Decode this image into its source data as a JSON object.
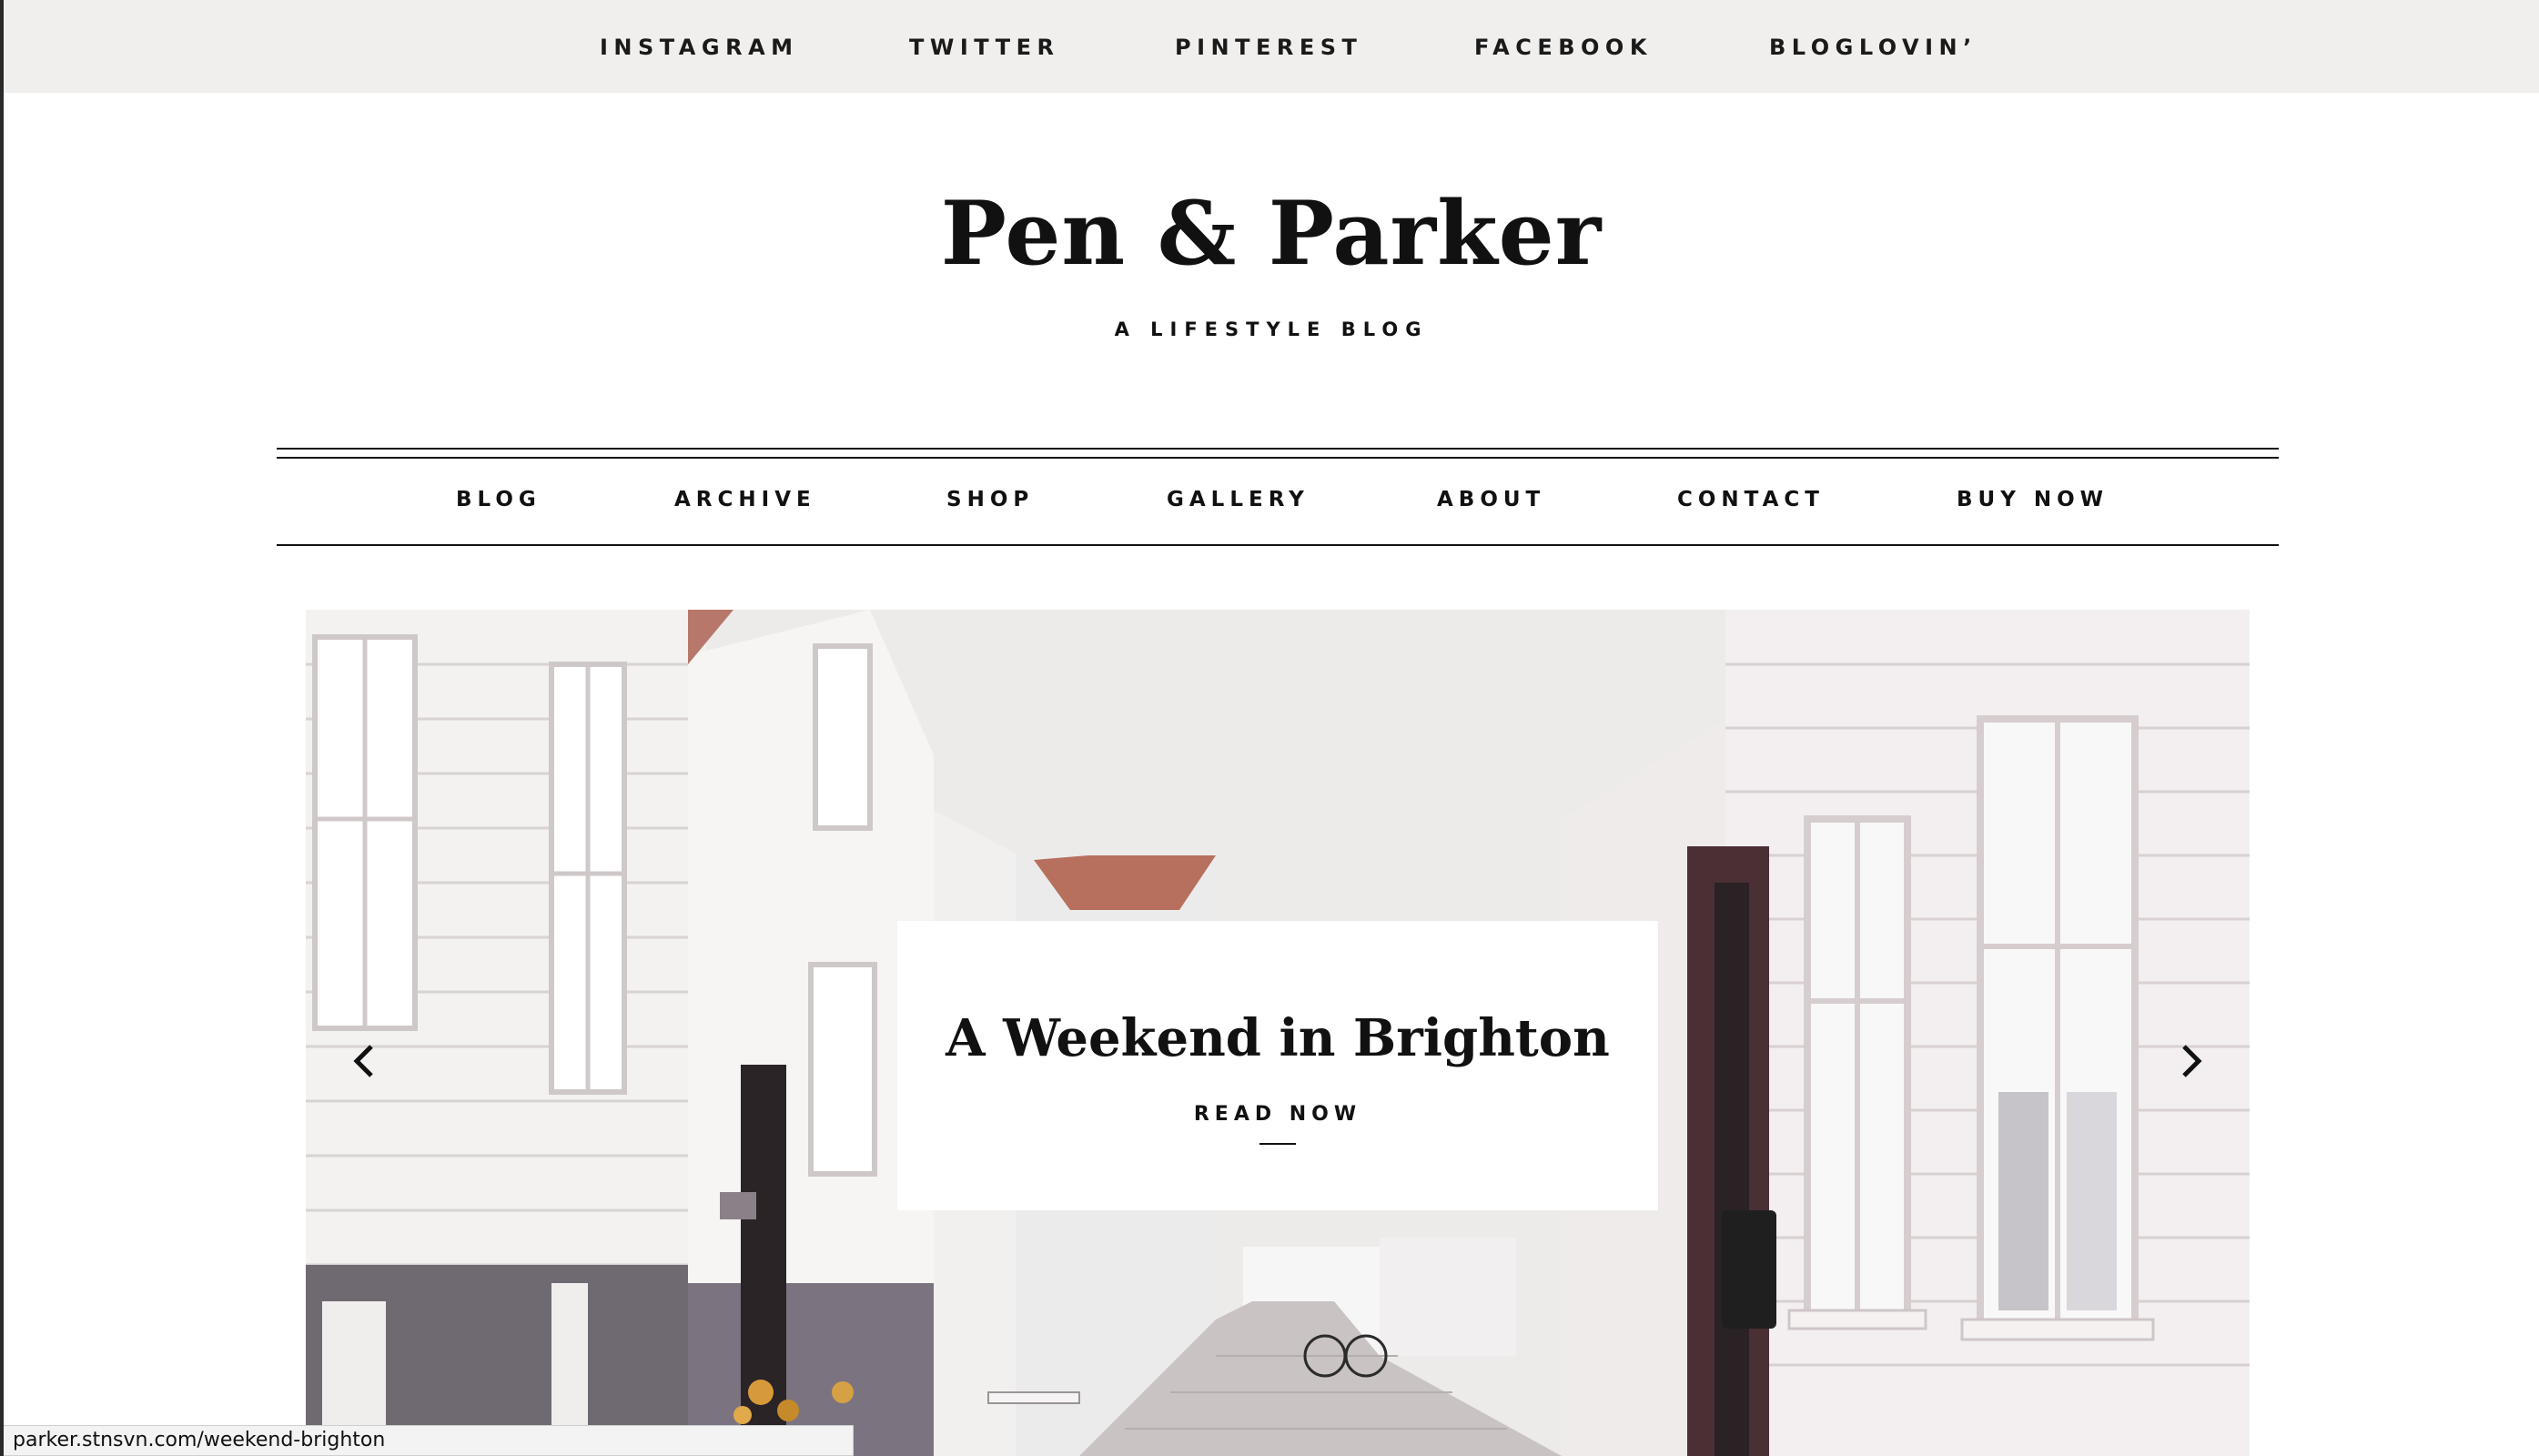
{
  "social": {
    "items": [
      {
        "label": "INSTAGRAM"
      },
      {
        "label": "TWITTER"
      },
      {
        "label": "PINTEREST"
      },
      {
        "label": "FACEBOOK"
      },
      {
        "label": "BLOGLOVIN’"
      }
    ]
  },
  "header": {
    "title": "Pen & Parker",
    "tagline": "A LIFESTYLE BLOG"
  },
  "nav": {
    "items": [
      {
        "label": "BLOG"
      },
      {
        "label": "ARCHIVE"
      },
      {
        "label": "SHOP"
      },
      {
        "label": "GALLERY"
      },
      {
        "label": "ABOUT"
      },
      {
        "label": "CONTACT"
      },
      {
        "label": "BUY NOW"
      }
    ]
  },
  "hero": {
    "title": "A Weekend in Brighton",
    "cta": "READ NOW",
    "prev_icon": "chevron-left-icon",
    "next_icon": "chevron-right-icon"
  },
  "status_bar": {
    "url": "parker.stnsvn.com/weekend-brighton"
  },
  "colors": {
    "social_bar_bg": "#f0efed",
    "text": "#111111",
    "card_bg": "#ffffff"
  }
}
